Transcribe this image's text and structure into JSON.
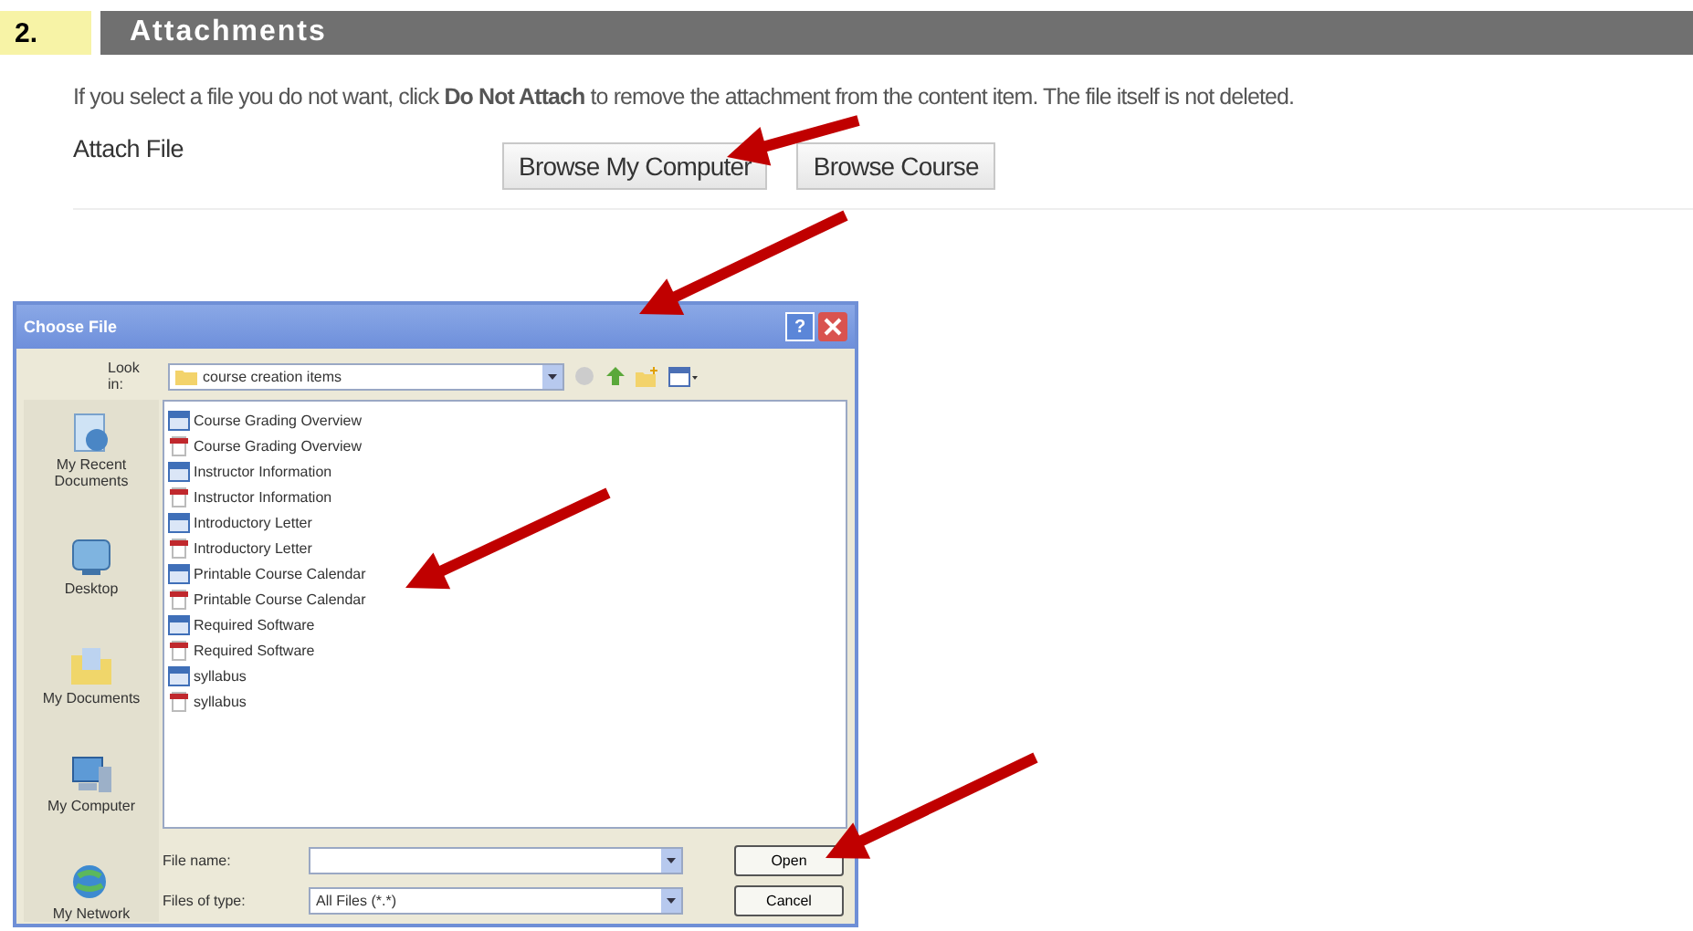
{
  "section": {
    "number": "2.",
    "title": "Attachments"
  },
  "instructions": "If you select a file you do not want, click **Do Not Attach** to remove the attachment from the content item. The file itself is not deleted.",
  "attach": {
    "label": "Attach File",
    "buttons": [
      "Browse My Computer",
      "Browse Course"
    ]
  },
  "dialog": {
    "title": "Choose File",
    "help_button": "?",
    "look_in_label": "Look in:",
    "look_in_value": "course creation items",
    "places": [
      {
        "label": "My Recent Documents",
        "kind": "recent"
      },
      {
        "label": "Desktop",
        "kind": "desktop"
      },
      {
        "label": "My Documents",
        "kind": "documents"
      },
      {
        "label": "My Computer",
        "kind": "computer"
      },
      {
        "label": "My Network",
        "kind": "network"
      }
    ],
    "files": [
      {
        "name": "Course Grading Overview",
        "kind": "doc"
      },
      {
        "name": "Course Grading Overview",
        "kind": "pdf"
      },
      {
        "name": "Instructor Information",
        "kind": "doc"
      },
      {
        "name": "Instructor Information",
        "kind": "pdf"
      },
      {
        "name": "Introductory Letter",
        "kind": "doc"
      },
      {
        "name": "Introductory Letter",
        "kind": "pdf"
      },
      {
        "name": "Printable Course Calendar",
        "kind": "doc"
      },
      {
        "name": "Printable Course Calendar",
        "kind": "pdf"
      },
      {
        "name": "Required Software",
        "kind": "doc"
      },
      {
        "name": "Required Software",
        "kind": "pdf"
      },
      {
        "name": "syllabus",
        "kind": "doc"
      },
      {
        "name": "syllabus",
        "kind": "pdf"
      }
    ],
    "file_name_label": "File name:",
    "file_type_label": "Files of type:",
    "file_type_value": "All Files (*.*)",
    "buttons": [
      "Open",
      "Cancel"
    ]
  }
}
